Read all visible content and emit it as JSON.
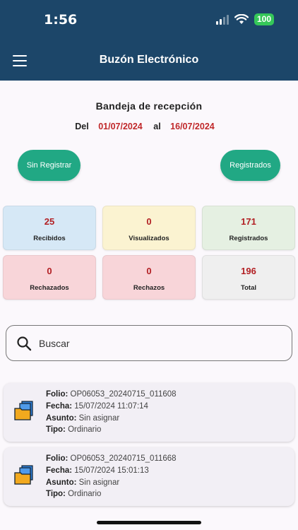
{
  "status_bar": {
    "time": "1:56",
    "battery": "100"
  },
  "header": {
    "title": "Buzón Electrónico"
  },
  "inbox": {
    "title": "Bandeja de recepción",
    "from_label": "Del",
    "from_date": "01/07/2024",
    "to_label": "al",
    "to_date": "16/07/2024"
  },
  "filters": {
    "unregistered_label": "Sin Registrar",
    "registered_label": "Registrados"
  },
  "stats": [
    {
      "value": "25",
      "label": "Recibidos",
      "color": "#d6e8f6"
    },
    {
      "value": "0",
      "label": "Visualizados",
      "color": "#fbf3d1"
    },
    {
      "value": "171",
      "label": "Registrados",
      "color": "#e5f0e2"
    },
    {
      "value": "0",
      "label": "Rechazados",
      "color": "#f8d5d9"
    },
    {
      "value": "0",
      "label": "Rechazos",
      "color": "#f8d5d9"
    },
    {
      "value": "196",
      "label": "Total",
      "color": "#efefef"
    }
  ],
  "search": {
    "placeholder": "Buscar"
  },
  "labels": {
    "folio": "Folio:",
    "fecha": "Fecha:",
    "asunto": "Asunto:",
    "tipo": "Tipo:"
  },
  "items": [
    {
      "folio": "OP06053_20240715_011608",
      "fecha": "15/07/2024 11:07:14",
      "asunto": "Sin asignar",
      "tipo": "Ordinario"
    },
    {
      "folio": "OP06053_20240715_011668",
      "fecha": "15/07/2024 15:01:13",
      "asunto": "Sin asignar",
      "tipo": "Ordinario"
    }
  ],
  "colors": {
    "header": "#1c4669",
    "accent": "#21a884",
    "value_red": "#b21f23"
  }
}
